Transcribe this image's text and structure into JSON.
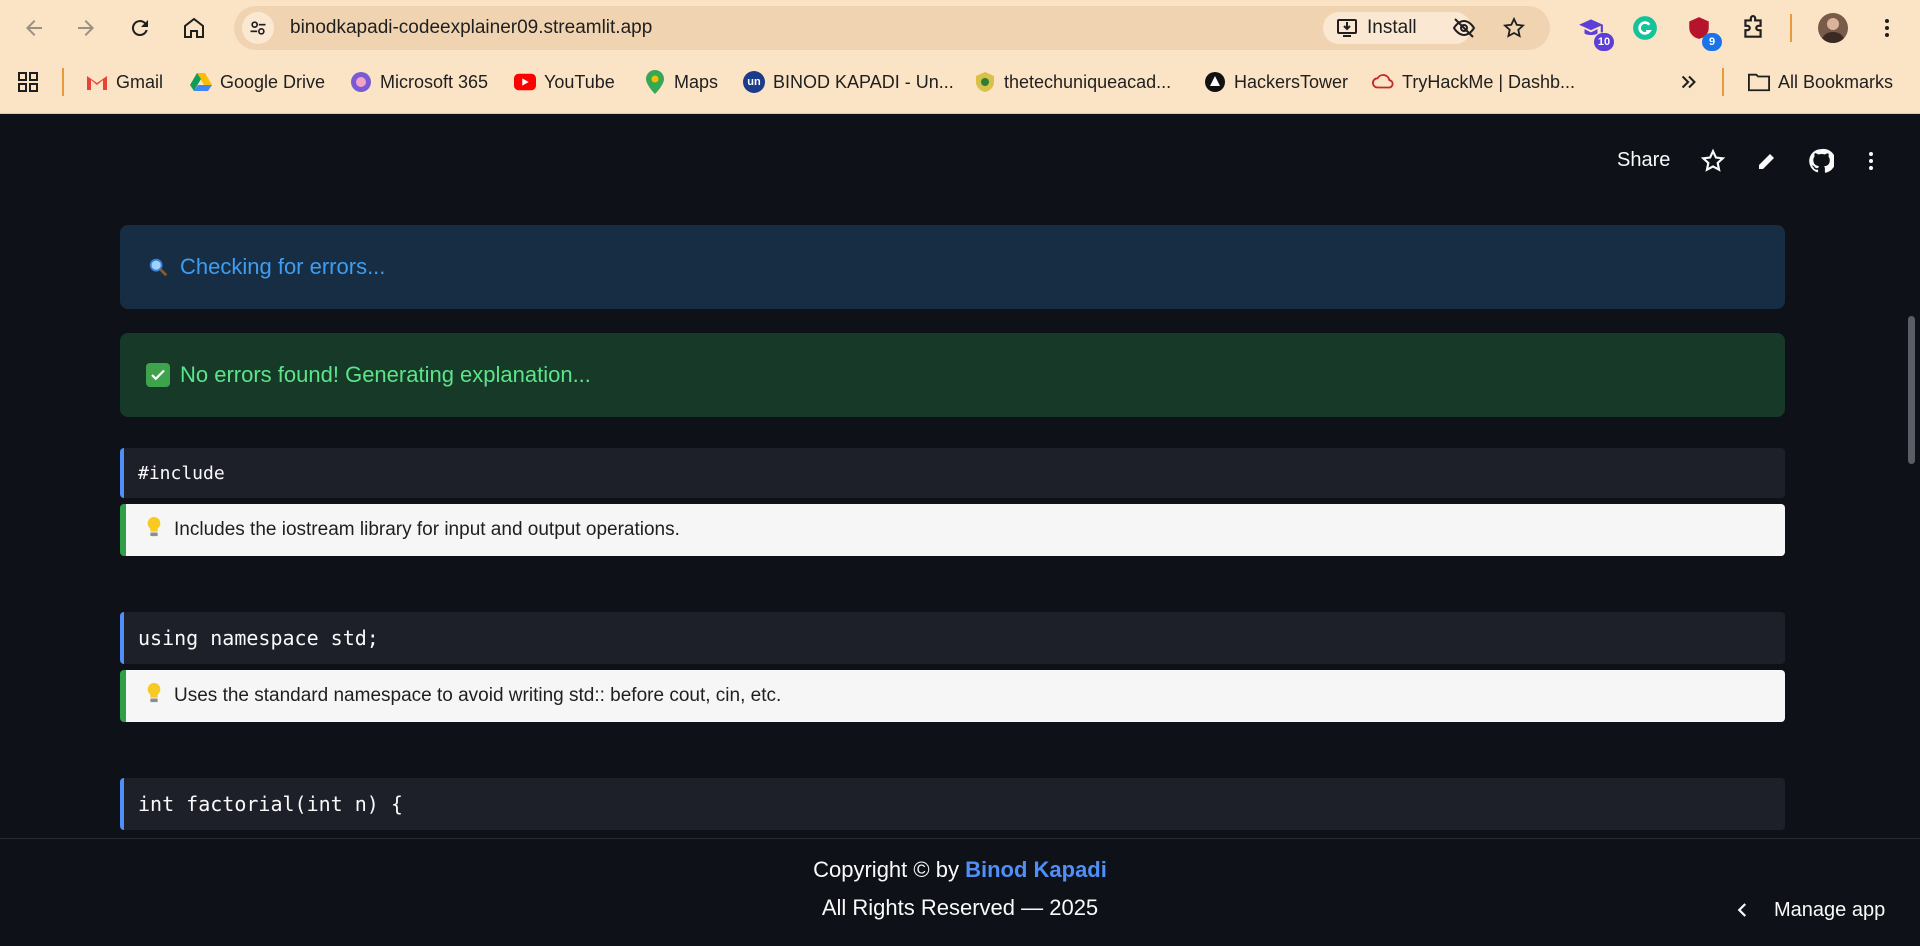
{
  "browser": {
    "url": "binodkapadi-codeexplainer09.streamlit.app",
    "install_label": "Install",
    "extensions": [
      {
        "name": "classroom-extension",
        "badge": "10",
        "badge_color": "#5b3fd6"
      },
      {
        "name": "grammarly-extension",
        "badge": "",
        "badge_color": ""
      },
      {
        "name": "shield-extension",
        "badge": "9",
        "badge_color": "#1a73e8"
      }
    ],
    "bookmarks": [
      {
        "label": "Gmail",
        "icon": "gmail-icon"
      },
      {
        "label": "Google Drive",
        "icon": "drive-icon"
      },
      {
        "label": "Microsoft 365",
        "icon": "m365-icon"
      },
      {
        "label": "YouTube",
        "icon": "youtube-icon"
      },
      {
        "label": "Maps",
        "icon": "maps-icon"
      },
      {
        "label": "BINOD KAPADI - Un...",
        "icon": "un-icon"
      },
      {
        "label": "thetechuniqueacad...",
        "icon": "academy-icon"
      },
      {
        "label": "HackersTower",
        "icon": "hackerstower-icon"
      },
      {
        "label": "TryHackMe | Dashb...",
        "icon": "tryhackme-icon"
      }
    ],
    "all_bookmarks_label": "All Bookmarks",
    "un_icon_text": "un"
  },
  "app": {
    "share_label": "Share",
    "info_message": "Checking for errors...",
    "success_message": "No errors found! Generating explanation...",
    "lines": [
      {
        "code": "#include",
        "explanation": "Includes the iostream library for input and output operations."
      },
      {
        "code": "using namespace std;",
        "explanation": "Uses the standard namespace to avoid writing std:: before cout, cin, etc."
      },
      {
        "code": "int factorial(int n) {",
        "explanation": ""
      }
    ],
    "footer": {
      "copyright_prefix": "Copyright © by",
      "author": "Binod Kapadi",
      "rights": "All Rights Reserved — 2025"
    },
    "manage_app_label": "Manage app",
    "colors": {
      "accent": "#4f8ff7",
      "info_text": "#3d9df3",
      "success_text": "#5ce488",
      "background": "#0e1117"
    }
  }
}
